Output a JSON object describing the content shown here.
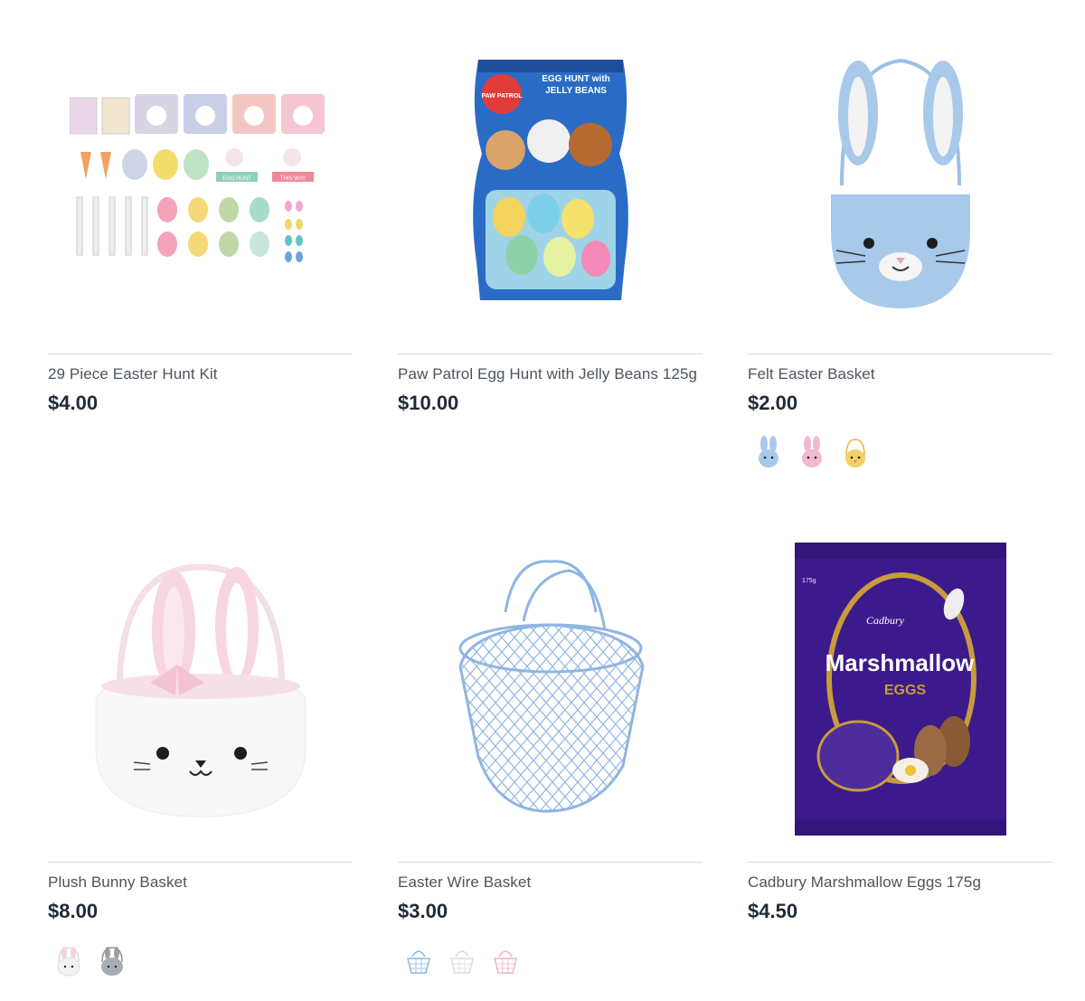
{
  "products": [
    {
      "title": "29 Piece Easter Hunt Kit",
      "price": "$4.00",
      "image": "easter-hunt-kit-image",
      "swatches": []
    },
    {
      "title": "Paw Patrol Egg Hunt with Jelly Beans 125g",
      "price": "$10.00",
      "image": "paw-patrol-egg-bag-image",
      "swatches": []
    },
    {
      "title": "Felt Easter Basket",
      "price": "$2.00",
      "image": "felt-bunny-basket-image",
      "swatches": [
        "blue",
        "pink",
        "yellow"
      ]
    },
    {
      "title": "Plush Bunny Basket",
      "price": "$8.00",
      "image": "plush-bunny-basket-image",
      "swatches": [
        "white",
        "grey"
      ]
    },
    {
      "title": "Easter Wire Basket",
      "price": "$3.00",
      "image": "wire-basket-image",
      "swatches": [
        "blue",
        "white",
        "pink"
      ]
    },
    {
      "title": "Cadbury Marshmallow Eggs 175g",
      "price": "$4.50",
      "image": "cadbury-marshmallow-eggs-image",
      "swatches": [],
      "package_text": {
        "brand": "Cadbury",
        "name": "Marshmallow",
        "sub": "EGGS",
        "weight": "175g"
      }
    }
  ],
  "paw_patrol_text": {
    "line1": "EGG HUNT with",
    "line2": "JELLY BEANS",
    "logo": "PAW PATROL"
  },
  "hunt_kit_text": {
    "sign1": "EGG HUNT",
    "sign2": "THIS WAY"
  },
  "colors": {
    "blue": "#a9c9ea",
    "pink": "#f2b8cf",
    "yellow": "#f5cf6a",
    "white": "#f3f3f3",
    "grey": "#9aa0a6",
    "cadbury_purple": "#3c1a8c",
    "gold": "#c89b3c"
  }
}
